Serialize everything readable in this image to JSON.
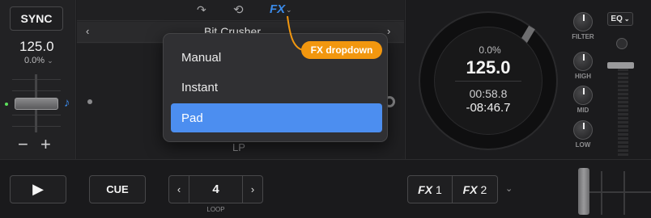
{
  "left_panel": {
    "sync_label": "SYNC",
    "bpm": "125.0",
    "pitch": "0.0%",
    "minus_label": "−",
    "plus_label": "+"
  },
  "top_bar": {
    "loop_icon": "loop-arrow-icon",
    "repeat_icon": "repeat-icon",
    "fx_tab_label": "FX"
  },
  "fx_bar": {
    "effect_name": "Bit Crusher",
    "pad_label": "LP"
  },
  "fx_dropdown": {
    "items": [
      {
        "label": "Manual"
      },
      {
        "label": "Instant"
      },
      {
        "label": "Pad"
      }
    ],
    "selected": "Pad"
  },
  "annotation": {
    "label": "FX dropdown",
    "color": "#f2970f"
  },
  "jog_wheel": {
    "pitch": "0.0%",
    "bpm": "125.0",
    "elapsed": "00:58.8",
    "remaining": "-08:46.7"
  },
  "mixer": {
    "eq_label": "EQ",
    "knobs": [
      {
        "label": "FILTER"
      },
      {
        "label": "HIGH"
      },
      {
        "label": "MID"
      },
      {
        "label": "LOW"
      }
    ]
  },
  "bottom_bar": {
    "cue_label": "CUE",
    "loop_value": "4",
    "loop_label": "LOOP",
    "fx1_prefix": "FX",
    "fx1_num": "1",
    "fx2_prefix": "FX",
    "fx2_num": "2"
  },
  "colors": {
    "accent": "#3b8bea",
    "selected_bg": "#4c8ef0",
    "callout": "#f2970f",
    "background": "#1c1c1e"
  }
}
